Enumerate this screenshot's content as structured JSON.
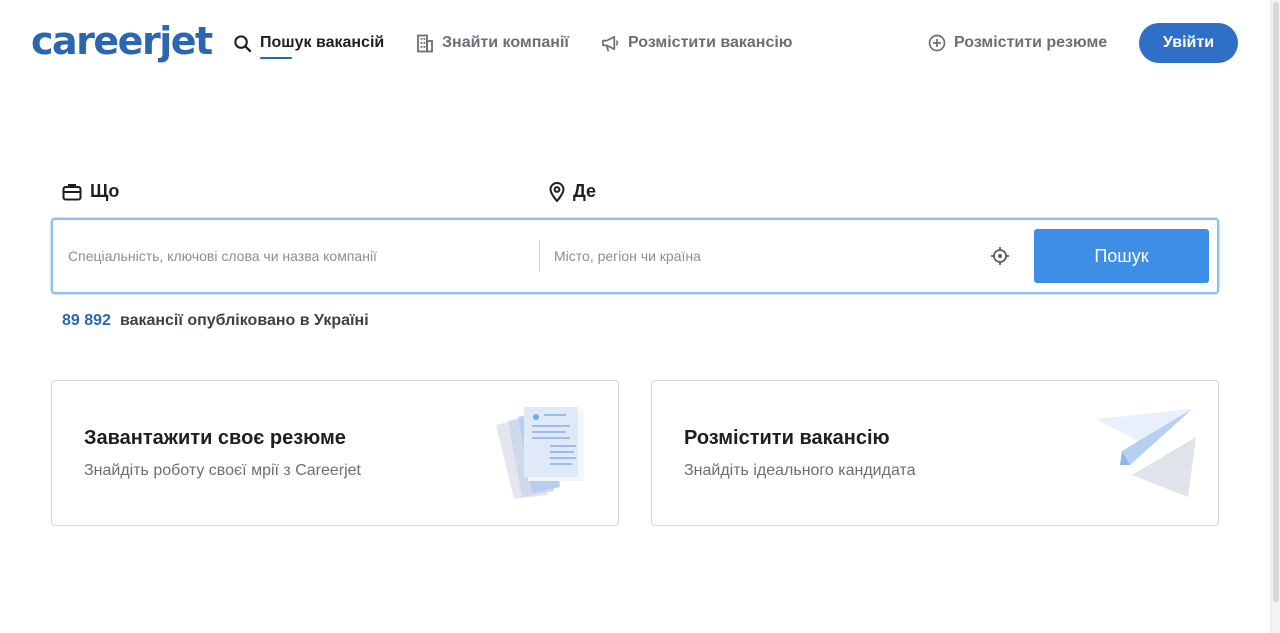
{
  "header": {
    "logo": "careerjet",
    "nav": [
      {
        "label": "Пошук вакансій",
        "icon": "search-icon"
      },
      {
        "label": "Знайти компанії",
        "icon": "building-icon"
      },
      {
        "label": "Розмістити вакансію",
        "icon": "megaphone-icon"
      }
    ],
    "post_resume": {
      "label": "Розмістити резюме",
      "icon": "plus-circle-icon"
    },
    "login_label": "Увійти"
  },
  "search": {
    "what_label": "Що",
    "where_label": "Де",
    "what_placeholder": "Спеціальність, ключові слова чи назва компанії",
    "where_placeholder": "Місто, регіон чи країна",
    "button_label": "Пошук"
  },
  "stats": {
    "count": "89 892",
    "text": "вакансії опубліковано в Україні"
  },
  "cards": [
    {
      "title": "Завантажити своє резюме",
      "subtitle": "Знайдіть роботу своєї мрії з Careerjet",
      "icon": "resume-documents-illustration"
    },
    {
      "title": "Розмістити вакансію",
      "subtitle": "Знайдіть ідеального кандидата",
      "icon": "paper-plane-illustration"
    }
  ],
  "colors": {
    "brand": "#2b66b1",
    "button": "#3d8ee4",
    "login": "#2f6fc6"
  }
}
